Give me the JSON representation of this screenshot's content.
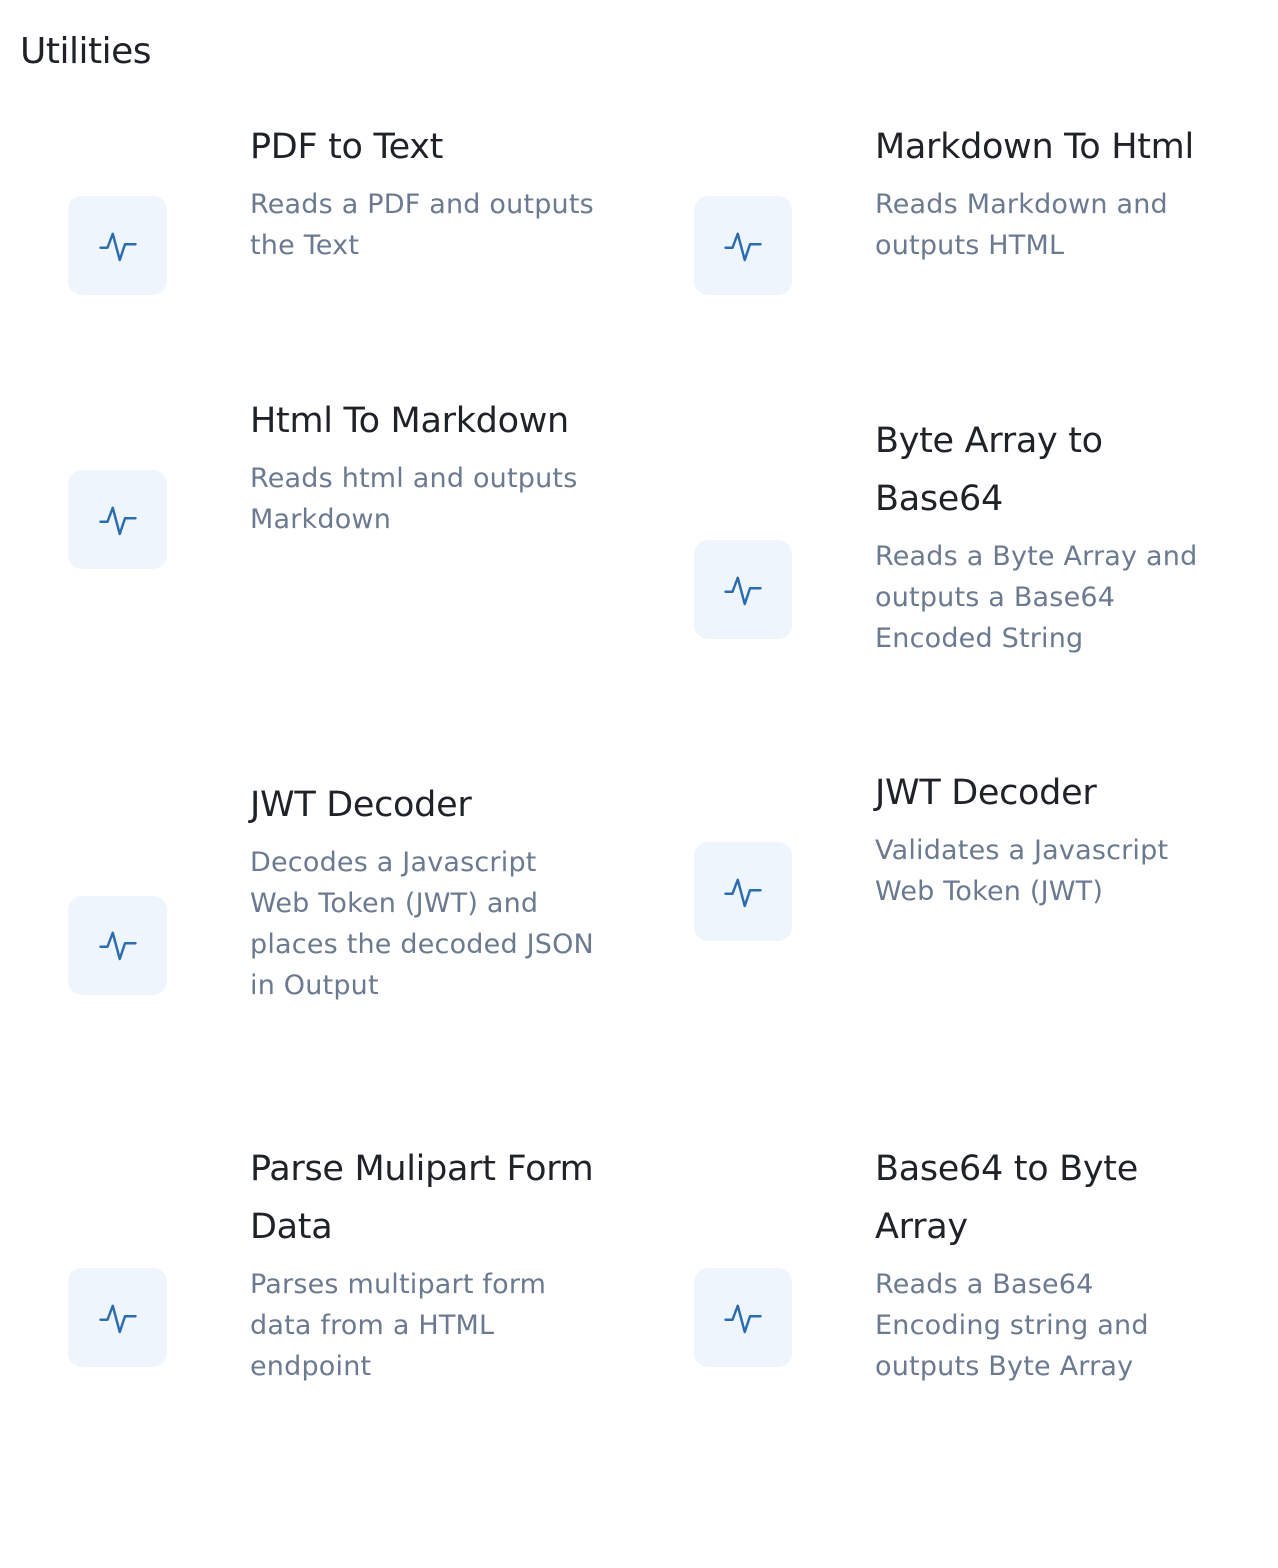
{
  "section": {
    "title": "Utilities"
  },
  "icon": {
    "name": "activity-icon",
    "tile_color": "#eef5fc",
    "stroke_color": "#2b6cb0"
  },
  "cards": [
    {
      "title": "PDF to Text",
      "description": "Reads a PDF and outputs the Text"
    },
    {
      "title": "Markdown To Html",
      "description": "Reads Markdown and outputs HTML"
    },
    {
      "title": "Html To Markdown",
      "description": "Reads html and outputs Markdown"
    },
    {
      "title": "Byte Array to Base64",
      "description": "Reads a Byte Array and outputs a Base64 Encoded String"
    },
    {
      "title": "JWT Decoder",
      "description": "Decodes a Javascript Web Token (JWT) and places the decoded JSON in Output"
    },
    {
      "title": "JWT Decoder",
      "description": "Validates a Javascript Web Token (JWT)"
    },
    {
      "title": "Parse Mulipart Form Data",
      "description": "Parses multipart form data from a HTML endpoint"
    },
    {
      "title": "Base64 to Byte Array",
      "description": "Reads a Base64 Encoding string and outputs Byte Array"
    }
  ]
}
